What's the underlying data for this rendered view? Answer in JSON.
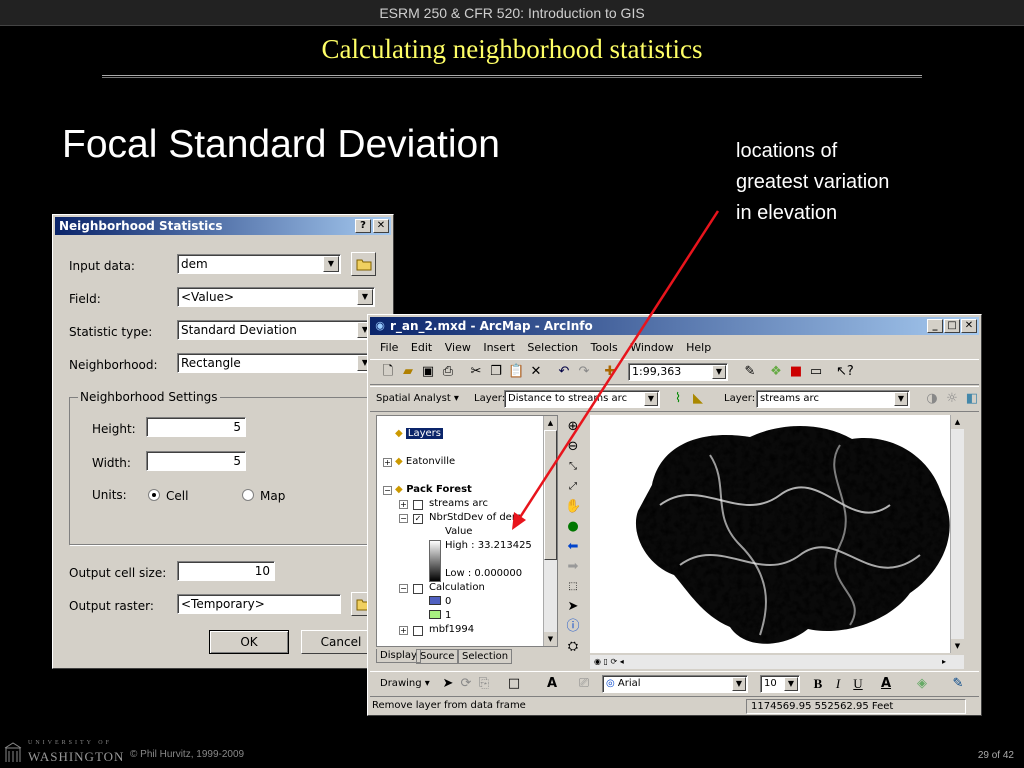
{
  "slide": {
    "header": "ESRM 250 & CFR 520: Introduction to GIS",
    "title": "Calculating neighborhood statistics",
    "heading": "Focal Standard Deviation",
    "note_lines": [
      "locations of",
      "greatest variation",
      "in elevation"
    ],
    "footer_university": "UNIVERSITY OF",
    "footer_washington": "WASHINGTON",
    "footer_copyright": "© Phil Hurvitz, 1999-2009",
    "footer_page": "29 of 42",
    "arrow_color": "#e8141c"
  },
  "dialog": {
    "title": "Neighborhood Statistics",
    "help_btn": "?",
    "close_btn": "✕",
    "input_data_label": "Input data:",
    "input_data_value": "dem",
    "field_label": "Field:",
    "field_value": "<Value>",
    "stat_type_label": "Statistic type:",
    "stat_type_value": "Standard Deviation",
    "neighborhood_label": "Neighborhood:",
    "neighborhood_value": "Rectangle",
    "settings_title": "Neighborhood Settings",
    "height_label": "Height:",
    "height_value": "5",
    "width_label": "Width:",
    "width_value": "5",
    "units_label": "Units:",
    "unit_cell": "Cell",
    "unit_map": "Map",
    "cell_size_label": "Output cell size:",
    "cell_size_value": "10",
    "output_raster_label": "Output raster:",
    "output_raster_value": "<Temporary>",
    "ok": "OK",
    "cancel": "Cancel"
  },
  "arcmap": {
    "title": "r_an_2.mxd - ArcMap - ArcInfo",
    "menu": [
      "File",
      "Edit",
      "View",
      "Insert",
      "Selection",
      "Tools",
      "Window",
      "Help"
    ],
    "scale": "1:99,363",
    "spatial_analyst": "Spatial Analyst",
    "layer_label": "Layer:",
    "sa_layer_value": "Distance to streams arc",
    "layer_value": "streams arc",
    "toc": {
      "layers": "Layers",
      "eatonville": "Eatonville",
      "pack_forest": "Pack Forest",
      "streams_arc": "streams arc",
      "nbr": "NbrStdDev of dem",
      "value": "Value",
      "high": "High : 33.213425",
      "low": "Low : 0.000000",
      "calculation": "Calculation",
      "calc0": "0",
      "calc1": "1",
      "mbf": "mbf1994"
    },
    "tabs": [
      "Display",
      "Source",
      "Selection"
    ],
    "drawing": "Drawing",
    "font": "Arial",
    "font_size": "10",
    "status_left": "Remove layer from data frame",
    "status_coords": "1174569.95  552562.95 Feet"
  }
}
